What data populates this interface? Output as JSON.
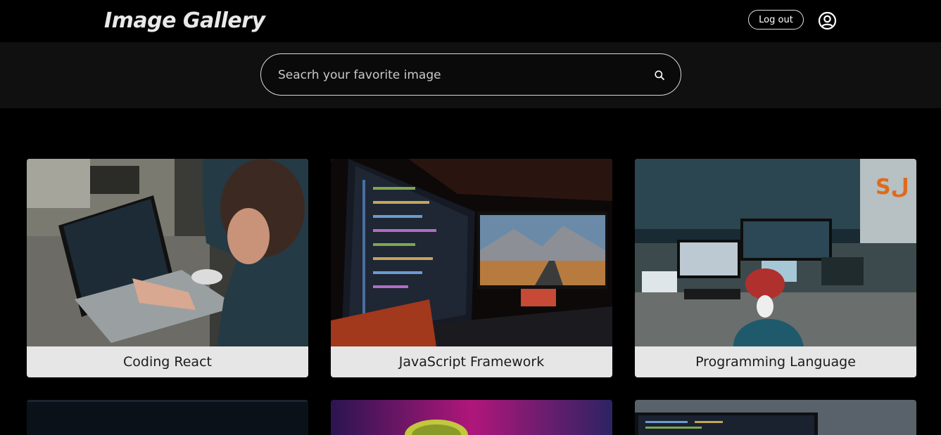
{
  "header": {
    "title": "Image Gallery",
    "logout_label": "Log out"
  },
  "search": {
    "placeholder": "Seacrh your favorite image"
  },
  "gallery": {
    "cards": [
      {
        "title": "Coding React"
      },
      {
        "title": "JavaScript Framework"
      },
      {
        "title": "Programming Language"
      }
    ]
  },
  "colors": {
    "background": "#000000",
    "search_band": "#101010",
    "caption_bg": "#e6e6e6",
    "caption_text": "#1b1b1b"
  },
  "icons": {
    "user": "user-circle-icon",
    "search": "search-icon"
  }
}
